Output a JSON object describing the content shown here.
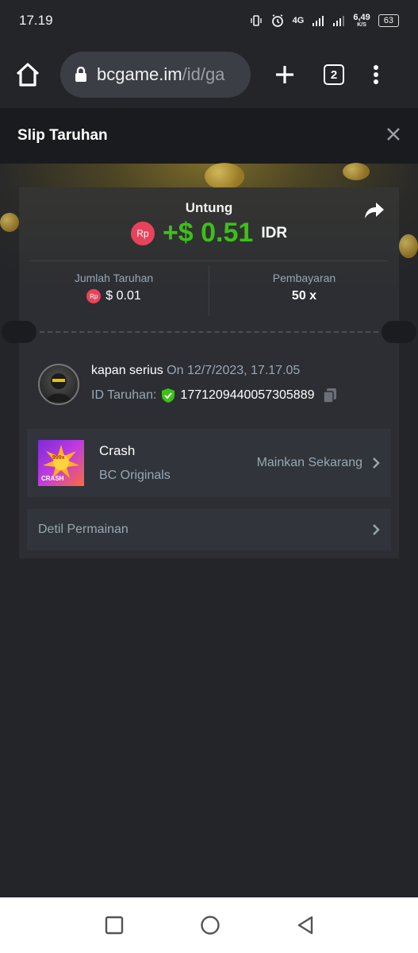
{
  "status_bar": {
    "time": "17.19",
    "network": "4G",
    "speed_value": "6,49",
    "speed_unit": "K/S",
    "battery": "63"
  },
  "browser": {
    "url_domain": "bcgame.im",
    "url_path": "/id/ga",
    "tab_count": "2"
  },
  "slip": {
    "title": "Slip Taruhan",
    "profit_label": "Untung",
    "profit_value": "+$ 0.51",
    "currency": "IDR",
    "currency_badge": "Rp",
    "bet_amount_label": "Jumlah Taruhan",
    "bet_amount": "$ 0.01",
    "payout_label": "Pembayaran",
    "payout": "50 x",
    "username": "kapan serius",
    "bet_time": "On 12/7/2023, 17.17.05",
    "bet_id_label": "ID Taruhan:",
    "bet_id": "1771209440057305889",
    "game_name": "Crash",
    "game_provider": "BC Originals",
    "game_thumb_badge": "999x",
    "game_thumb_label": "CRASH",
    "play_now": "Mainkan Sekarang",
    "game_details": "Detil Permainan"
  },
  "colors": {
    "profit": "#3bc117",
    "rp_badge": "#e8435a",
    "muted_text": "#98a7b5",
    "background": "#232529"
  }
}
